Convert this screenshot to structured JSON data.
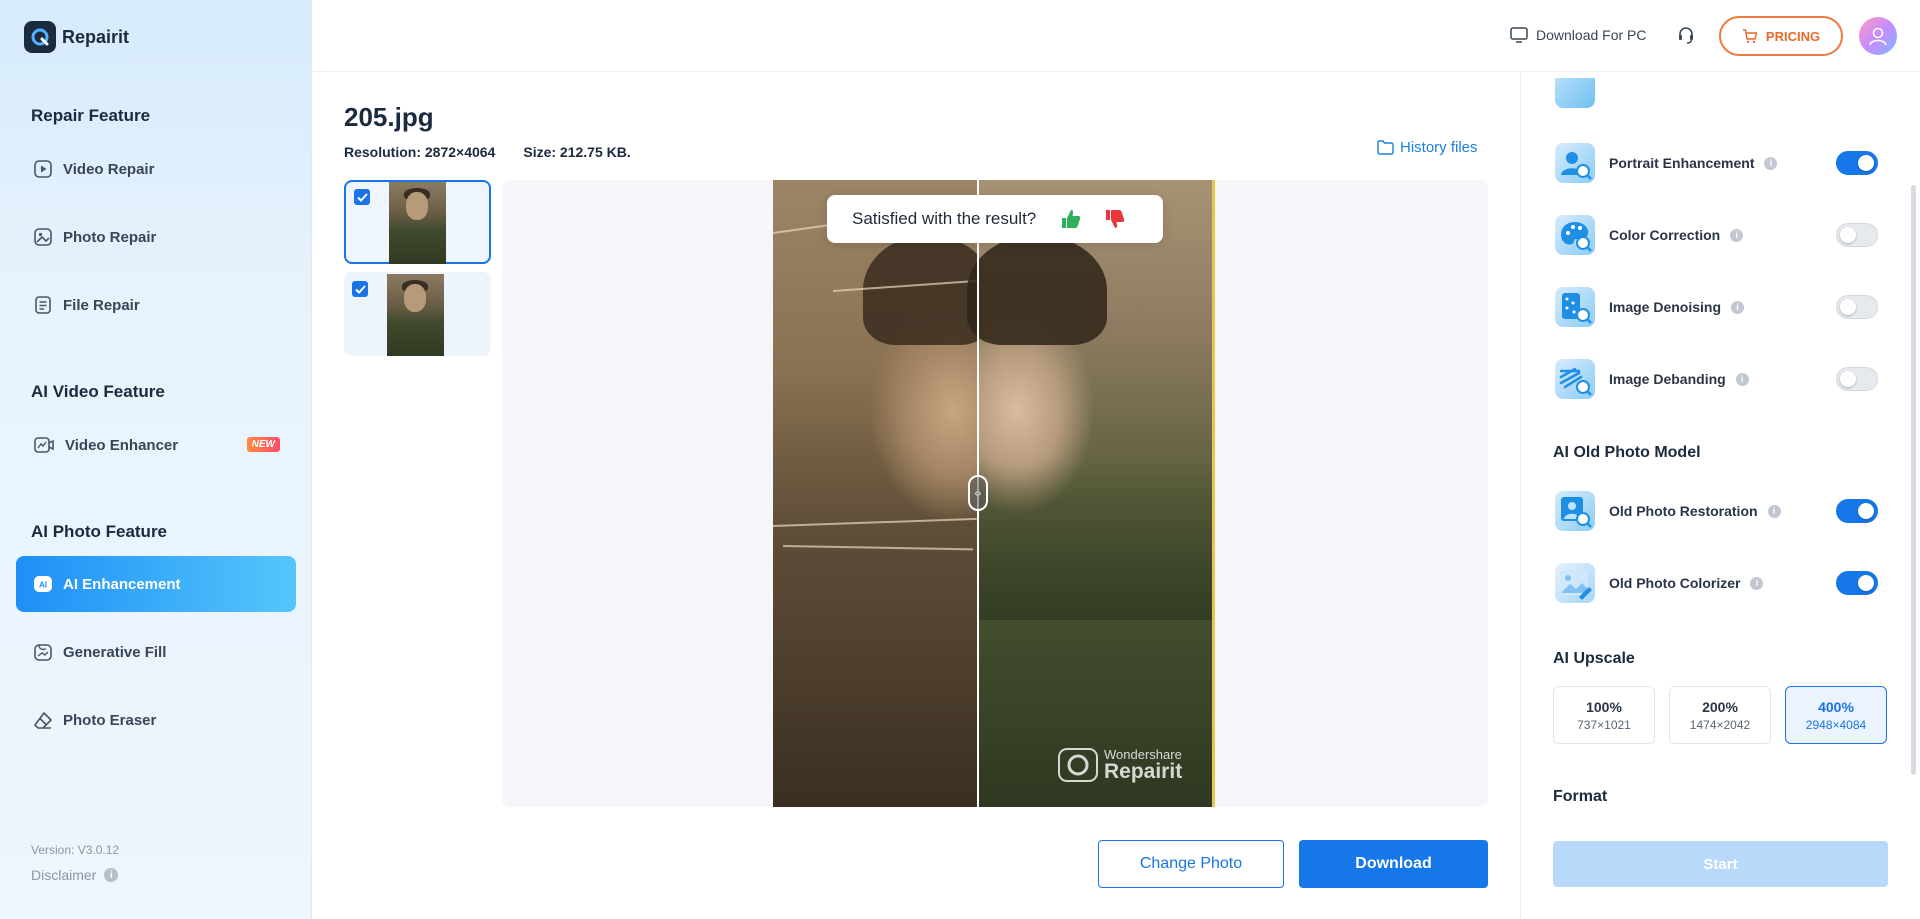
{
  "app": {
    "name": "Repairit"
  },
  "header": {
    "download_pc": "Download For PC",
    "pricing": "PRICING"
  },
  "sidebar": {
    "sections": [
      {
        "title": "Repair Feature"
      },
      {
        "title": "AI Video Feature"
      },
      {
        "title": "AI Photo Feature"
      }
    ],
    "items": [
      {
        "label": "Video Repair",
        "icon": "video-play-icon"
      },
      {
        "label": "Photo Repair",
        "icon": "photo-icon"
      },
      {
        "label": "File Repair",
        "icon": "file-icon"
      },
      {
        "label": "Video Enhancer",
        "icon": "video-enhance-icon",
        "badge": "NEW"
      },
      {
        "label": "AI Enhancement",
        "icon": "ai-icon",
        "active": true
      },
      {
        "label": "Generative Fill",
        "icon": "generative-fill-icon"
      },
      {
        "label": "Photo Eraser",
        "icon": "eraser-icon"
      }
    ],
    "version": "Version: V3.0.12",
    "disclaimer": "Disclaimer"
  },
  "main": {
    "file_name": "205.jpg",
    "resolution": "Resolution: 2872×4064",
    "size": "Size: 212.75 KB.",
    "history": "History files",
    "feedback_prompt": "Satisfied with the result?",
    "watermark_small": "Wondershare",
    "watermark_big": "Repairit",
    "change_photo": "Change Photo",
    "download": "Download"
  },
  "right_panel": {
    "features": [
      {
        "label": "Portrait Enhancement",
        "on": true
      },
      {
        "label": "Color Correction",
        "on": false
      },
      {
        "label": "Image Denoising",
        "on": false
      },
      {
        "label": "Image Debanding",
        "on": false
      }
    ],
    "old_photo_title": "AI Old Photo Model",
    "old_photo": [
      {
        "label": "Old Photo Restoration",
        "on": true
      },
      {
        "label": "Old Photo Colorizer",
        "on": true
      }
    ],
    "upscale_title": "AI Upscale",
    "upscale": [
      {
        "pct": "100%",
        "res": "737×1021"
      },
      {
        "pct": "200%",
        "res": "1474×2042"
      },
      {
        "pct": "400%",
        "res": "2948×4084",
        "selected": true
      }
    ],
    "format_title": "Format",
    "start": "Start"
  },
  "colors": {
    "accent": "#1677e8",
    "pricing": "#ea6a2c",
    "active_nav_start": "#1e8ff6",
    "active_nav_end": "#55c6fb"
  }
}
